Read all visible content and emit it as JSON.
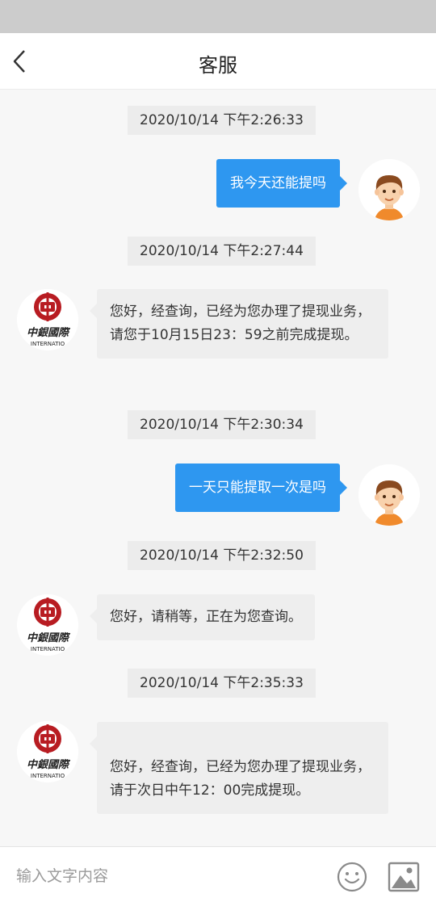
{
  "header": {
    "title": "客服"
  },
  "messages": [
    {
      "timestamp": "2020/10/14 下午2:26:33",
      "sender": "user",
      "text": "我今天还能提吗"
    },
    {
      "timestamp": "2020/10/14 下午2:27:44",
      "sender": "agent",
      "text": "您好，经查询，已经为您办理了提现业务，请您于10月15日23：59之前完成提现。"
    },
    {
      "timestamp": "2020/10/14 下午2:30:34",
      "sender": "user",
      "text": "一天只能提取一次是吗"
    },
    {
      "timestamp": "2020/10/14 下午2:32:50",
      "sender": "agent",
      "text": "您好，请稍等，正在为您查询。"
    },
    {
      "timestamp": "2020/10/14 下午2:35:33",
      "sender": "agent",
      "text": "您好，经查询，已经为您办理了提现业务，请于次日中午12：00完成提现。"
    }
  ],
  "agent_logo": {
    "icon": "bank-logo-icon",
    "brand_color": "#b81c22",
    "caption": "中銀國際",
    "subcaption": "INTERNATIO"
  },
  "user_avatar": {
    "icon": "user-avatar-icon"
  },
  "input_bar": {
    "placeholder": "输入文字内容",
    "value": "",
    "emoji_icon": "emoji-icon",
    "image_icon": "image-icon"
  },
  "colors": {
    "outgoing_bubble": "#2e97f0",
    "incoming_bubble": "#eeeeee",
    "timestamp_bg": "#ececec",
    "background": "#f7f7f7"
  }
}
